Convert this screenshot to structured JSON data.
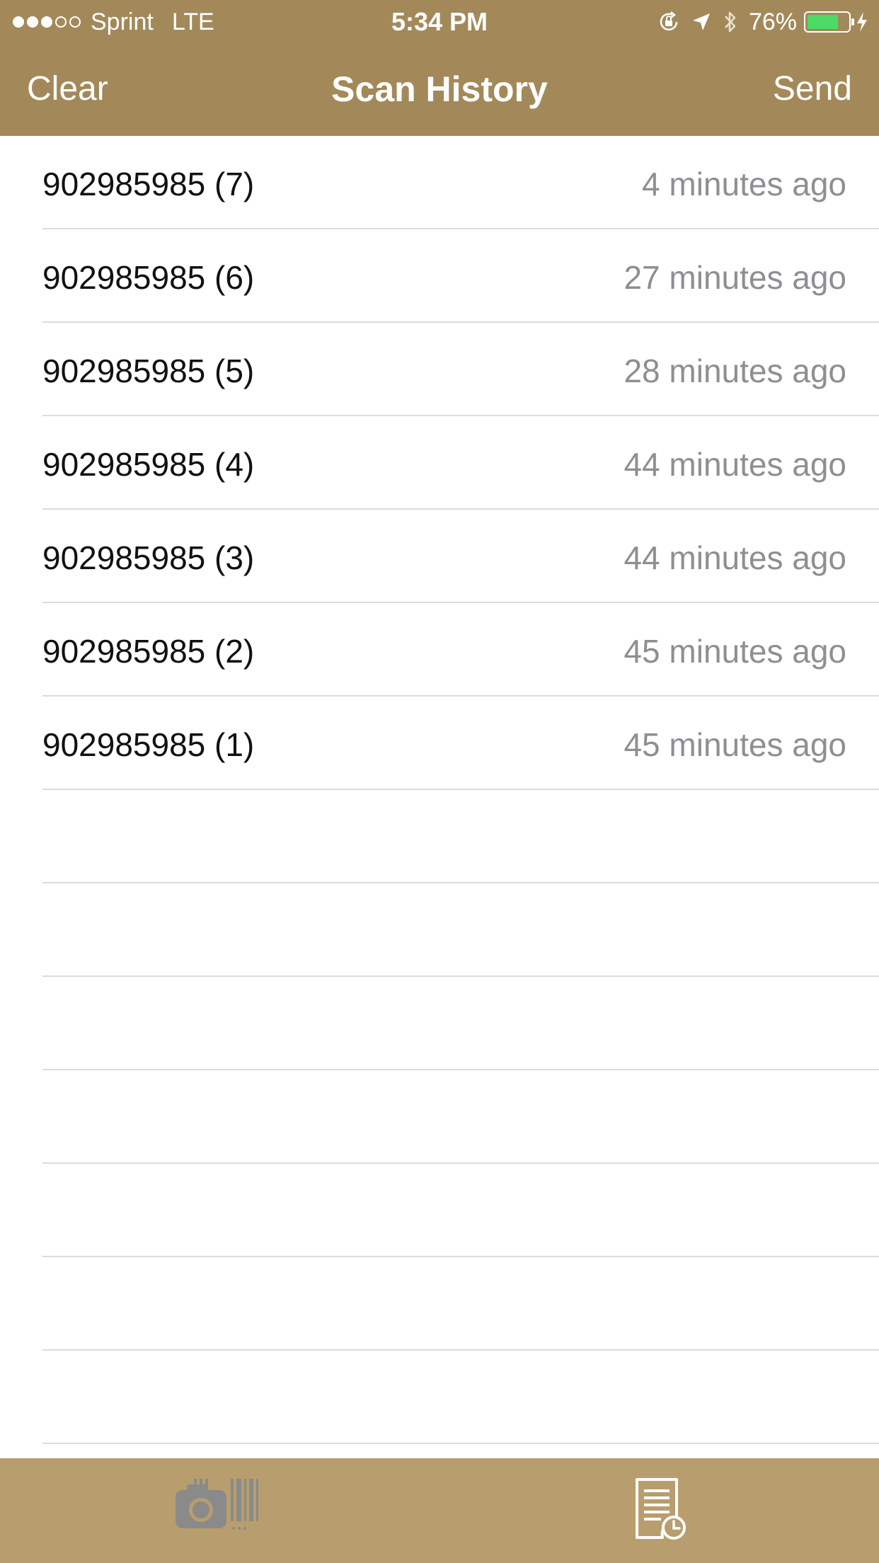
{
  "status_bar": {
    "carrier": "Sprint",
    "network": "LTE",
    "time": "5:34 PM",
    "battery": "76%",
    "battery_level": 0.76,
    "icons": [
      "signal-icon",
      "rotation-lock-icon",
      "location-icon",
      "bluetooth-icon",
      "battery-icon",
      "charging-icon"
    ]
  },
  "nav": {
    "left_label": "Clear",
    "title": "Scan History",
    "right_label": "Send"
  },
  "scans": [
    {
      "code": "902985985 (7)",
      "time": "4 minutes ago"
    },
    {
      "code": "902985985 (6)",
      "time": "27 minutes ago"
    },
    {
      "code": "902985985 (5)",
      "time": "28 minutes ago"
    },
    {
      "code": "902985985 (4)",
      "time": "44 minutes ago"
    },
    {
      "code": "902985985 (3)",
      "time": "44 minutes ago"
    },
    {
      "code": "902985985 (2)",
      "time": "45 minutes ago"
    },
    {
      "code": "902985985 (1)",
      "time": "45 minutes ago"
    }
  ],
  "tab_bar": {
    "tabs": [
      {
        "icon": "barcode-camera-icon",
        "selected": false
      },
      {
        "icon": "scan-history-icon",
        "selected": true
      }
    ]
  },
  "colors": {
    "nav_background": "#a3895a",
    "tab_background": "#b89e6e",
    "tab_inactive": "#8a8a8a",
    "tab_active": "#ffffff",
    "battery_fill": "#4cd964",
    "secondary_text": "#8e8e93"
  }
}
